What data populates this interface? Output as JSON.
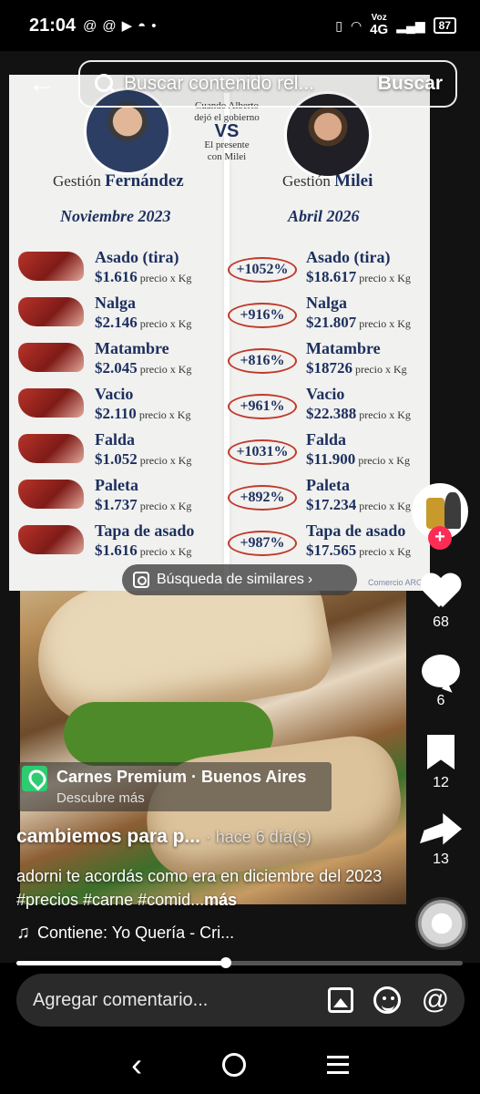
{
  "status_bar": {
    "time": "21:04",
    "network_top": "Voz",
    "network_main": "4G",
    "battery": "87"
  },
  "search": {
    "placeholder": "Buscar contenido rel...",
    "button_label": "Buscar"
  },
  "infographic": {
    "left_title_prefix": "Gestión",
    "left_title_name": "Fernández",
    "right_title_prefix": "Gestión",
    "right_title_name": "Milei",
    "left_period": "Noviembre 2023",
    "right_period": "Abril 2026",
    "vs_top_line1": "Cuando Alberto",
    "vs_top_line2": "dejó el gobierno",
    "vs_label": "VS",
    "vs_bottom_line1": "El presente",
    "vs_bottom_line2": "con Milei",
    "per_kg_label": "precio x Kg",
    "source": "Comercio ARG",
    "cuts": [
      {
        "name": "Asado (tira)",
        "left_price": "$1.616",
        "change": "+1052%",
        "right_price": "$18.617"
      },
      {
        "name": "Nalga",
        "left_price": "$2.146",
        "change": "+916%",
        "right_price": "$21.807"
      },
      {
        "name": "Matambre",
        "left_price": "$2.045",
        "change": "+816%",
        "right_price": "$18726"
      },
      {
        "name": "Vacio",
        "left_price": "$2.110",
        "change": "+961%",
        "right_price": "$22.388"
      },
      {
        "name": "Falda",
        "left_price": "$1.052",
        "change": "+1031%",
        "right_price": "$11.900"
      },
      {
        "name": "Paleta",
        "left_price": "$1.737",
        "change": "+892%",
        "right_price": "$17.234"
      },
      {
        "name": "Tapa de asado",
        "left_price": "$1.616",
        "change": "+987%",
        "right_price": "$17.565"
      }
    ]
  },
  "similar_search": {
    "label": "Búsqueda de similares",
    "chevron": "›"
  },
  "actions": {
    "likes": "68",
    "comments": "6",
    "saves": "12",
    "shares": "13"
  },
  "location": {
    "title": "Carnes Premium · Buenos Aires",
    "subtitle": "Descubre más"
  },
  "caption": {
    "title": "cambiemos para p...",
    "time_ago": "· hace 6 día(s)",
    "body": "adorni te acordás como era en diciembre del 2023 #precios #carne #comid...",
    "more": "más"
  },
  "sound": {
    "label": "Contiene: Yo Quería - Cri..."
  },
  "progress": {
    "fraction": 0.47
  },
  "comment_bar": {
    "placeholder": "Agregar comentario...",
    "mention_symbol": "@"
  },
  "colors": {
    "accent": "#fe2c55",
    "location_pin": "#2ecc71",
    "navy_text": "#1c2f5e",
    "percent_ring": "#c0392b"
  }
}
